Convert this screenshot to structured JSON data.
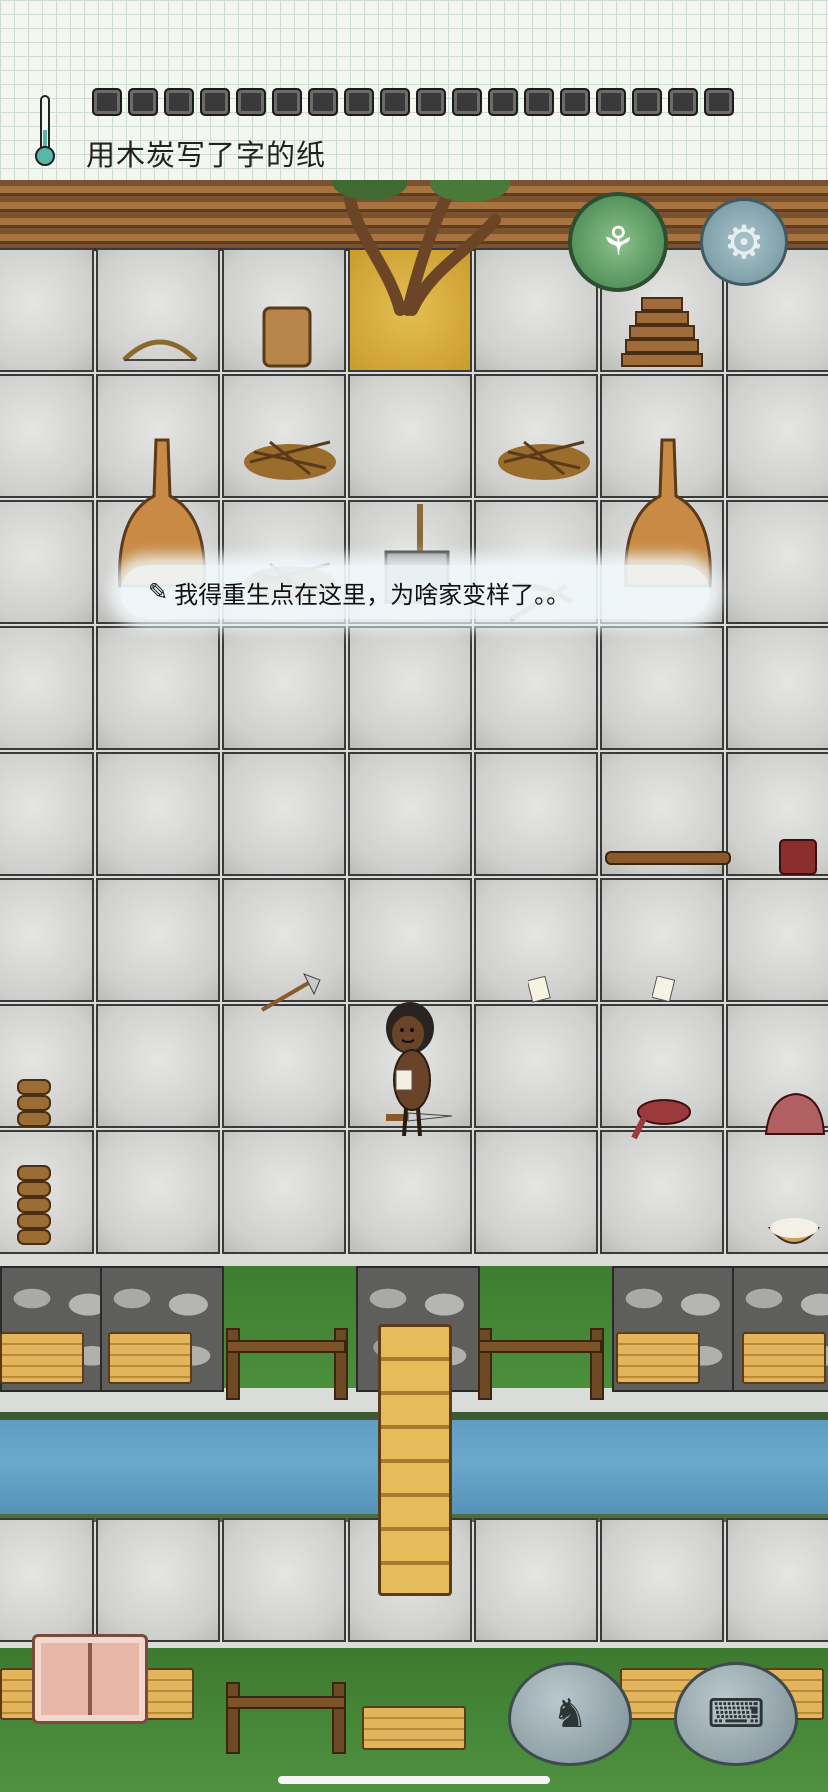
{
  "hud": {
    "held_item_label": "用木炭写了字的纸",
    "hunger_pips_total": 18,
    "temperature_icon": "thermometer-icon"
  },
  "speech": {
    "text": "我得重生点在这里，为啥家变样了。。",
    "icon": "paper-note-icon"
  },
  "buttons": {
    "compass": "compass-icon",
    "settings": "gear-icon",
    "book": "recipe-book-icon",
    "emote": "puppet-emote-icon",
    "keyboard": "keyboard-icon"
  },
  "colors": {
    "grass": "#4c8f3b",
    "water": "#6aa9cb",
    "floor": "#d4d5d2",
    "wood": "#e2b55c"
  }
}
